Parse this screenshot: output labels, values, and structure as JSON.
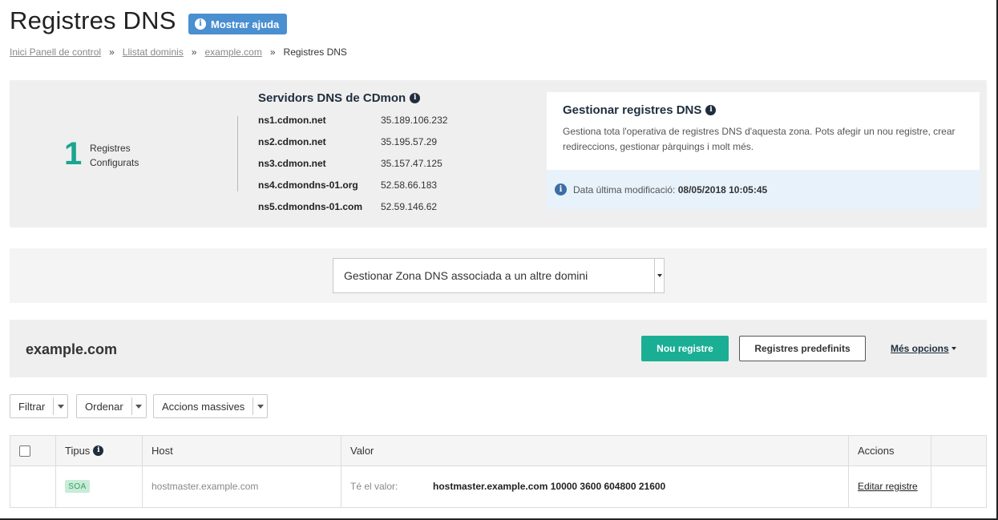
{
  "header": {
    "title": "Registres DNS",
    "help_label": "Mostrar ajuda"
  },
  "breadcrumb": {
    "items": [
      "Inici Panell de control",
      "Llistat dominis",
      "example.com"
    ],
    "separator": "»",
    "current": "Registres DNS"
  },
  "stats": {
    "count": "1",
    "label_line1": "Registres",
    "label_line2": "Configurats"
  },
  "dns_servers": {
    "title": "Servidors DNS de CDmon",
    "servers": [
      {
        "name": "ns1.cdmon.net",
        "ip": "35.189.106.232"
      },
      {
        "name": "ns2.cdmon.net",
        "ip": "35.195.57.29"
      },
      {
        "name": "ns3.cdmon.net",
        "ip": "35.157.47.125"
      },
      {
        "name": "ns4.cdmondns-01.org",
        "ip": "52.58.66.183"
      },
      {
        "name": "ns5.cdmondns-01.com",
        "ip": "52.59.146.62"
      }
    ]
  },
  "manage": {
    "title": "Gestionar registres DNS",
    "description": "Gestiona tota l'operativa de registres DNS d'aquesta zona. Pots afegir un nou registre, crear redireccions, gestionar pàrquings i molt més.",
    "last_mod_label": "Data última modificació:",
    "last_mod_value": "08/05/2018 10:05:45"
  },
  "zone_select": {
    "selected": "Gestionar Zona DNS associada a un altre domini"
  },
  "domain_bar": {
    "domain": "example.com",
    "new_record": "Nou registre",
    "predefined": "Registres predefinits",
    "more_options": "Més opcions"
  },
  "filters": {
    "filter": "Filtrar",
    "sort": "Ordenar",
    "bulk": "Accions massives"
  },
  "table": {
    "headers": {
      "type": "Tipus",
      "host": "Host",
      "value": "Valor",
      "actions": "Accions"
    },
    "rows": [
      {
        "type": "SOA",
        "host": "hostmaster.example.com",
        "value_label": "Té el valor:",
        "value": "hostmaster.example.com 10000 3600 604800 21600",
        "action": "Editar registre"
      }
    ]
  },
  "colors": {
    "accent_green": "#1aaf94",
    "help_blue": "#4a8fd0",
    "navy": "#1f2d3d"
  }
}
